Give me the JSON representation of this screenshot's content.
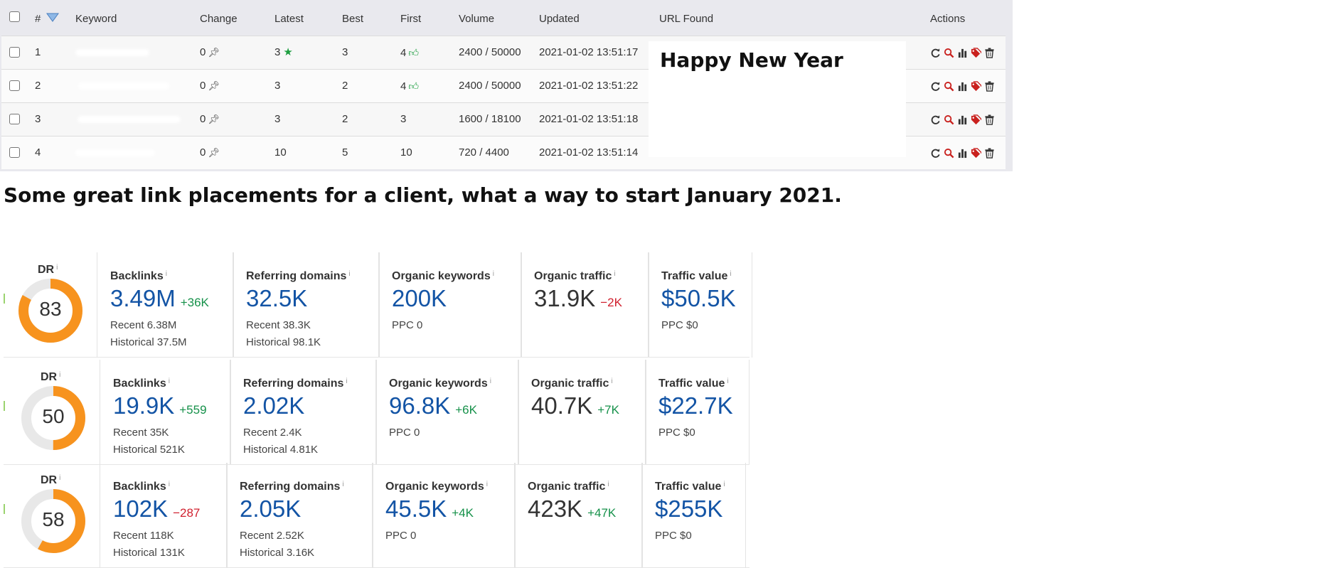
{
  "table": {
    "headers": {
      "rank": "#",
      "keyword": "Keyword",
      "change": "Change",
      "latest": "Latest",
      "best": "Best",
      "first": "First",
      "volume": "Volume",
      "updated": "Updated",
      "url_found": "URL Found",
      "actions": "Actions"
    },
    "rows": [
      {
        "rank": "1",
        "change": "0",
        "latest": "3",
        "latest_star": true,
        "best": "3",
        "first": "4",
        "first_thumb": true,
        "volume": "2400 / 50000",
        "updated": "2021-01-02 13:51:17"
      },
      {
        "rank": "2",
        "change": "0",
        "latest": "3",
        "latest_star": false,
        "best": "2",
        "first": "4",
        "first_thumb": true,
        "volume": "2400 / 50000",
        "updated": "2021-01-02 13:51:22"
      },
      {
        "rank": "3",
        "change": "0",
        "latest": "3",
        "latest_star": false,
        "best": "2",
        "first": "3",
        "first_thumb": false,
        "volume": "1600 / 18100",
        "updated": "2021-01-02 13:51:18"
      },
      {
        "rank": "4",
        "change": "0",
        "latest": "10",
        "latest_star": false,
        "best": "5",
        "first": "10",
        "first_thumb": false,
        "volume": "720 / 4400",
        "updated": "2021-01-02 13:51:14"
      }
    ],
    "action_icons": [
      "refresh-icon",
      "search-icon",
      "bar-chart-icon",
      "tag-icon",
      "trash-icon"
    ]
  },
  "note": "Happy New Year",
  "caption": "Some great link placements for a client, what a way to start January 2021.",
  "metric_rows": [
    {
      "dr": {
        "label": "DR",
        "value": 83
      },
      "backlinks": {
        "label": "Backlinks",
        "value": "3.49M",
        "delta": "+36K",
        "recent": "Recent 6.38M",
        "historical": "Historical 37.5M"
      },
      "referring_domains": {
        "label": "Referring domains",
        "value": "32.5K",
        "delta": "",
        "recent": "Recent 38.3K",
        "historical": "Historical 98.1K"
      },
      "organic_keywords": {
        "label": "Organic keywords",
        "value": "200K",
        "delta": "",
        "sub": "PPC 0"
      },
      "organic_traffic": {
        "label": "Organic traffic",
        "value": "31.9K",
        "delta": "−2K"
      },
      "traffic_value": {
        "label": "Traffic value",
        "value": "$50.5K",
        "sub": "PPC $0"
      }
    },
    {
      "dr": {
        "label": "DR",
        "value": 50
      },
      "backlinks": {
        "label": "Backlinks",
        "value": "19.9K",
        "delta": "+559",
        "recent": "Recent 35K",
        "historical": "Historical 521K"
      },
      "referring_domains": {
        "label": "Referring domains",
        "value": "2.02K",
        "delta": "",
        "recent": "Recent 2.4K",
        "historical": "Historical 4.81K"
      },
      "organic_keywords": {
        "label": "Organic keywords",
        "value": "96.8K",
        "delta": "+6K",
        "sub": "PPC 0"
      },
      "organic_traffic": {
        "label": "Organic traffic",
        "value": "40.7K",
        "delta": "+7K"
      },
      "traffic_value": {
        "label": "Traffic value",
        "value": "$22.7K",
        "sub": "PPC $0"
      }
    },
    {
      "dr": {
        "label": "DR",
        "value": 58
      },
      "backlinks": {
        "label": "Backlinks",
        "value": "102K",
        "delta": "−287",
        "recent": "Recent 118K",
        "historical": "Historical 131K"
      },
      "referring_domains": {
        "label": "Referring domains",
        "value": "2.05K",
        "delta": "",
        "recent": "Recent 2.52K",
        "historical": "Historical 3.16K"
      },
      "organic_keywords": {
        "label": "Organic keywords",
        "value": "45.5K",
        "delta": "+4K",
        "sub": "PPC 0"
      },
      "organic_traffic": {
        "label": "Organic traffic",
        "value": "423K",
        "delta": "+47K"
      },
      "traffic_value": {
        "label": "Traffic value",
        "value": "$255K",
        "sub": "PPC $0"
      }
    }
  ],
  "info_glyph": "i",
  "colors": {
    "accent_blue": "#1354a5",
    "up_green": "#16914a",
    "down_red": "#d0202e",
    "dr_orange": "#f7931e",
    "icon_green": "#1d9e40"
  }
}
